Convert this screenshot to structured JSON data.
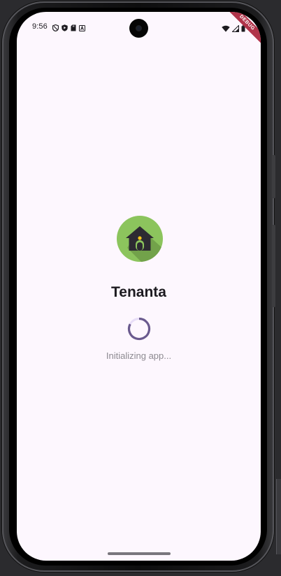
{
  "status_bar": {
    "time": "9:56",
    "left_icons": [
      "shield-icon",
      "play-protect-icon",
      "sd-card-icon",
      "a-badge-icon"
    ],
    "right_icons": [
      "wifi-icon",
      "cellular-signal-icon",
      "battery-icon"
    ]
  },
  "debug_banner": {
    "label": "DEBUG",
    "color": "#b0344a"
  },
  "splash": {
    "app_name": "Tenanta",
    "loading_message": "Initializing app...",
    "logo_icon": "house-icon",
    "logo_color": "#8cc45d",
    "spinner_color": "#6a5a8e"
  },
  "theme": {
    "screen_background": "#fdf7fe",
    "text_primary": "#1d1b20",
    "text_secondary": "#8d8a91"
  }
}
